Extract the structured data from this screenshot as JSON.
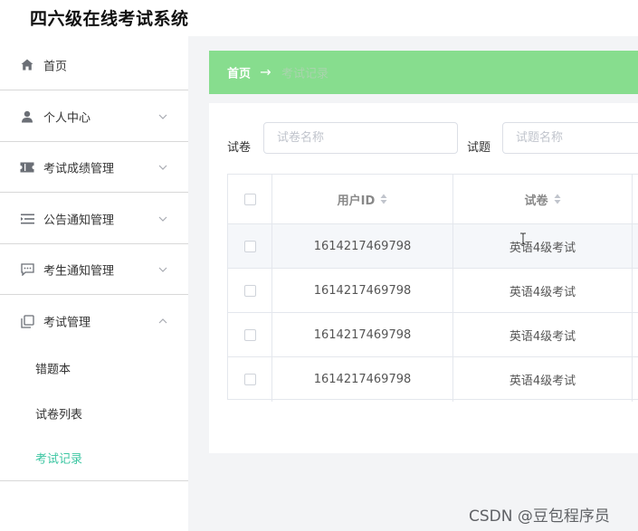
{
  "app": {
    "title": "四六级在线考试系统"
  },
  "sidebar": {
    "items": [
      {
        "label": "首页",
        "icon": "home-icon",
        "expandable": false
      },
      {
        "label": "个人中心",
        "icon": "user-icon",
        "expandable": true,
        "expanded": false
      },
      {
        "label": "考试成绩管理",
        "icon": "ticket-icon",
        "expandable": true,
        "expanded": false
      },
      {
        "label": "公告通知管理",
        "icon": "list-icon",
        "expandable": true,
        "expanded": false
      },
      {
        "label": "考生通知管理",
        "icon": "message-icon",
        "expandable": true,
        "expanded": false
      },
      {
        "label": "考试管理",
        "icon": "copy-icon",
        "expandable": true,
        "expanded": true
      }
    ],
    "sub_items": [
      {
        "label": "错题本",
        "active": false
      },
      {
        "label": "试卷列表",
        "active": false
      },
      {
        "label": "考试记录",
        "active": true
      }
    ],
    "active_color": "#3cc6a2"
  },
  "breadcrumb": {
    "home": "首页",
    "separator": "→",
    "current": "考试记录",
    "bar_color": "#87dd8e"
  },
  "filters": {
    "paper": {
      "label": "试卷",
      "placeholder": "试卷名称",
      "value": ""
    },
    "question": {
      "label": "试题",
      "placeholder": "试题名称",
      "value": ""
    }
  },
  "table": {
    "columns": [
      {
        "label": "用户ID",
        "sortable": true
      },
      {
        "label": "试卷",
        "sortable": true
      }
    ],
    "rows": [
      {
        "user_id": "1614217469798",
        "paper": "英语4级考试"
      },
      {
        "user_id": "1614217469798",
        "paper": "英语4级考试"
      },
      {
        "user_id": "1614217469798",
        "paper": "英语4级考试"
      },
      {
        "user_id": "1614217469798",
        "paper": "英语4级考试"
      }
    ]
  },
  "watermark": "CSDN @豆包程序员"
}
